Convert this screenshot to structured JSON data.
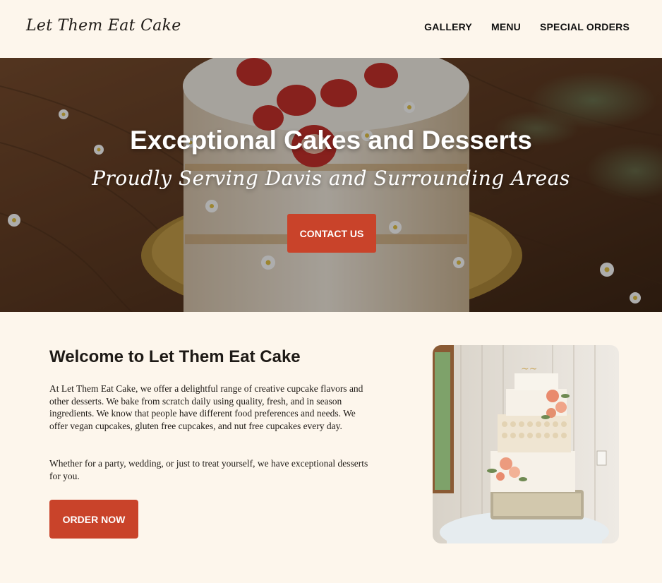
{
  "header": {
    "logo": "Let Them Eat Cake",
    "nav": [
      "GALLERY",
      "MENU",
      "SPECIAL ORDERS"
    ]
  },
  "hero": {
    "title": "Exceptional Cakes and Desserts",
    "subtitle": "Proudly Serving Davis and Surrounding Areas",
    "cta_label": "CONTACT US"
  },
  "welcome": {
    "title": "Welcome to Let Them Eat Cake",
    "paragraph1": "At Let Them Eat Cake, we offer a delightful range of creative cupcake flavors and other desserts. We bake from scratch daily using quality, fresh, and in season ingredients. We know that people have different food preferences and needs. We offer vegan cupcakes, gluten free cupcakes, and nut free cupcakes every day.",
    "paragraph2": "Whether for a party, wedding, or just to treat yourself, we have exceptional desserts for you.",
    "cta_label": "ORDER NOW"
  },
  "colors": {
    "background": "#fdf6ec",
    "accent": "#c9432a",
    "text": "#1e1a16"
  }
}
